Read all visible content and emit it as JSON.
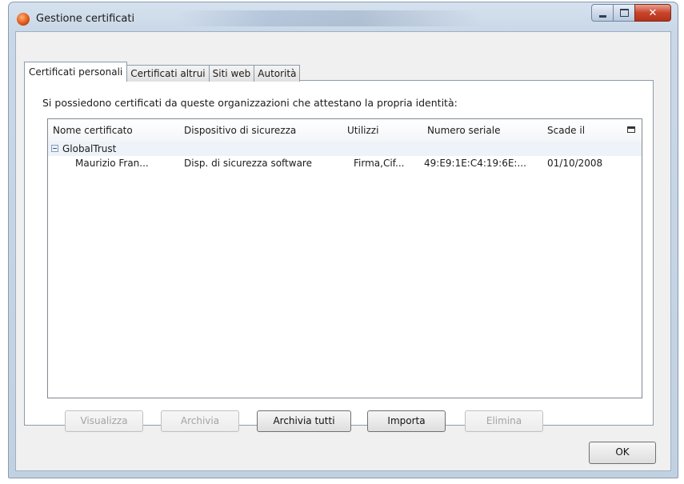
{
  "window": {
    "title": "Gestione certificati",
    "close_glyph": "✕"
  },
  "tabs": [
    {
      "label": "Certificati personali",
      "active": true
    },
    {
      "label": "Certificati altrui",
      "active": false
    },
    {
      "label": "Siti web",
      "active": false
    },
    {
      "label": "Autorità",
      "active": false
    }
  ],
  "panel": {
    "intro": "Si possiedono certificati da queste organizzazioni che attestano la propria identità:"
  },
  "table": {
    "columns": [
      "Nome certificato",
      "Dispositivo di sicurezza",
      "Utilizzi",
      "Numero seriale",
      "Scade il"
    ],
    "groups": [
      {
        "name": "GlobalTrust",
        "rows": [
          {
            "name": "Maurizio Fran...",
            "device": "Disp. di sicurezza software",
            "usage": "Firma,Cif...",
            "serial": "49:E9:1E:C4:19:6E:...",
            "expires": "01/10/2008"
          }
        ]
      }
    ]
  },
  "buttons": {
    "view": "Visualizza",
    "backup": "Archivia",
    "backup_all": "Archivia tutti",
    "import": "Importa",
    "delete": "Elimina",
    "ok": "OK"
  },
  "icons": {
    "app": "firefox-icon",
    "column_picker": "column-picker-icon",
    "collapse": "minus-icon"
  }
}
